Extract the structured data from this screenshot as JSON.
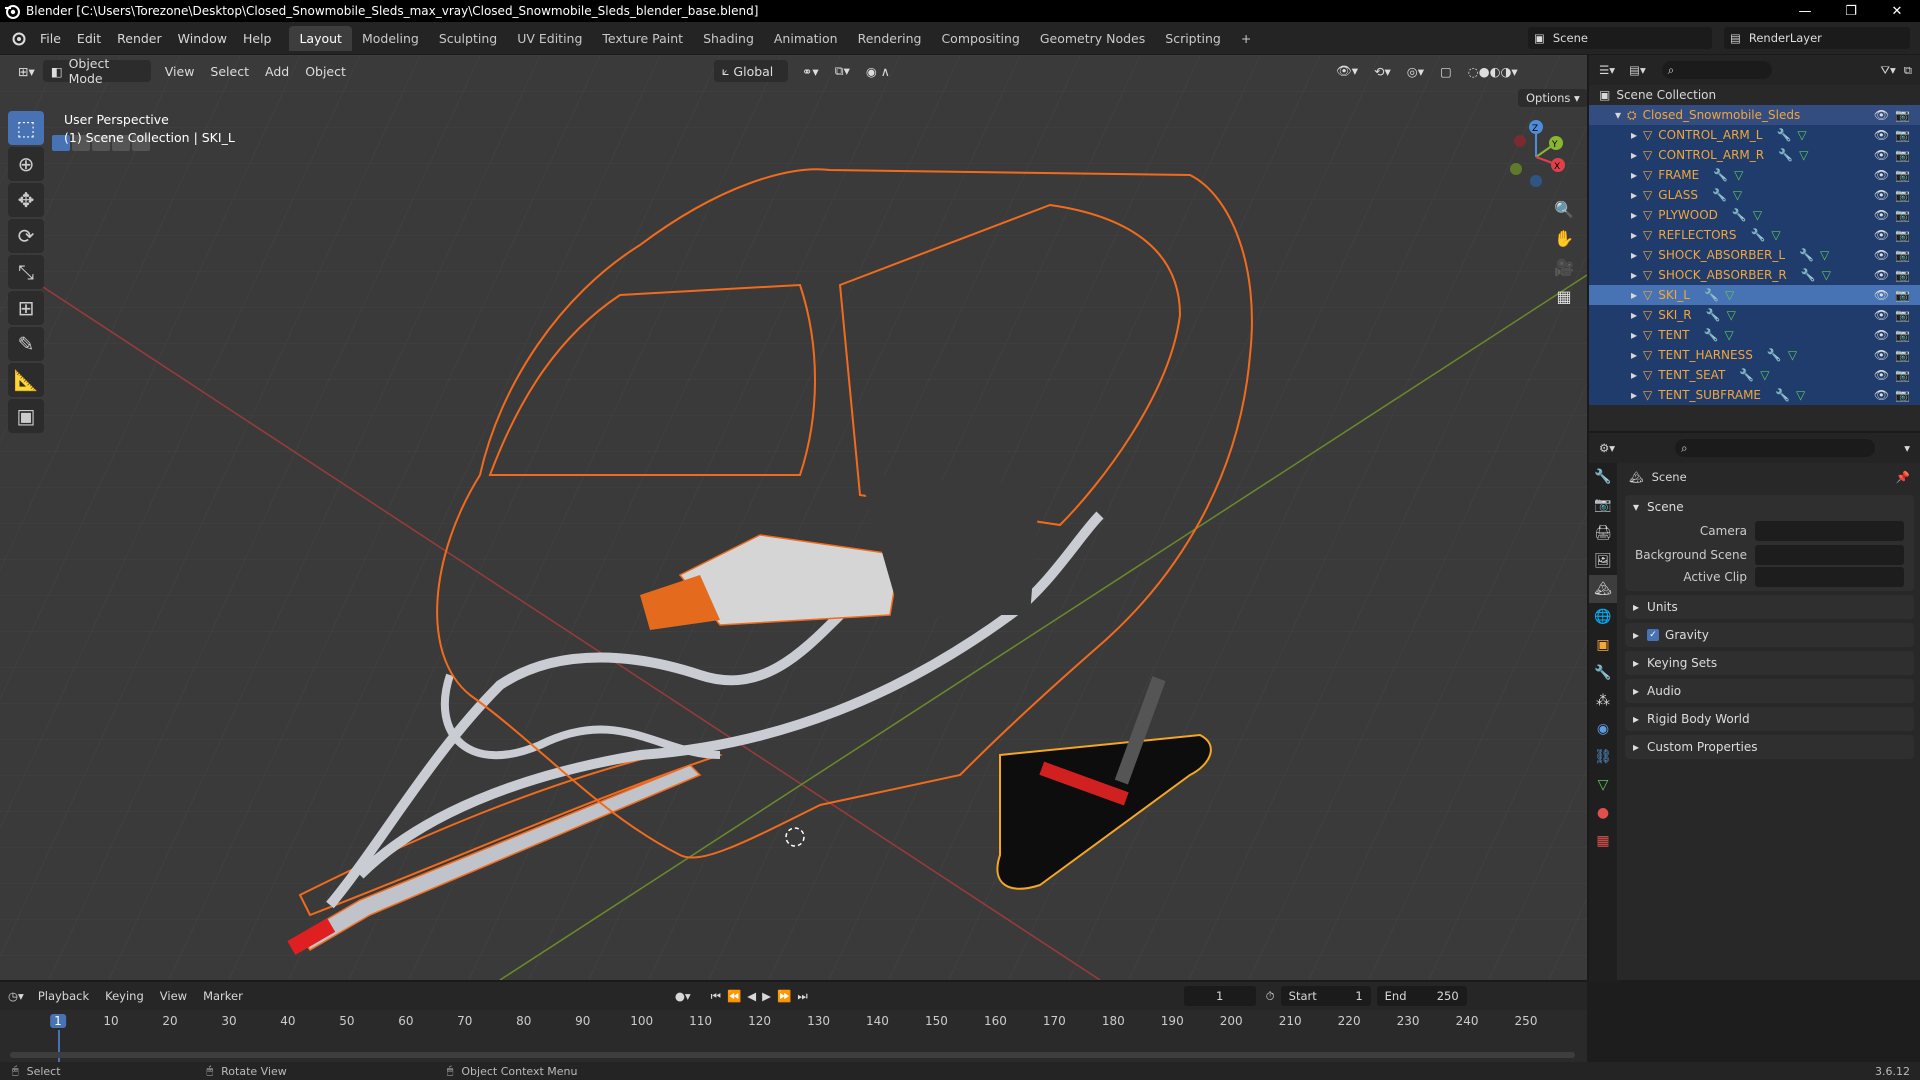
{
  "window": {
    "title": "Blender [C:\\Users\\Torezone\\Desktop\\Closed_Snowmobile_Sleds_max_vray\\Closed_Snowmobile_Sleds_blender_base.blend]"
  },
  "menu": [
    "File",
    "Edit",
    "Render",
    "Window",
    "Help"
  ],
  "workspaces": [
    "Layout",
    "Modeling",
    "Sculpting",
    "UV Editing",
    "Texture Paint",
    "Shading",
    "Animation",
    "Rendering",
    "Compositing",
    "Geometry Nodes",
    "Scripting"
  ],
  "active_workspace": "Layout",
  "scene_name": "Scene",
  "view_layer": "RenderLayer",
  "viewport": {
    "mode": "Object Mode",
    "menus": [
      "View",
      "Select",
      "Add",
      "Object"
    ],
    "transform_orientation": "Global",
    "options_label": "Options",
    "perspective": "User Perspective",
    "collection_info": "(1) Scene Collection | SKI_L"
  },
  "outliner": {
    "root": "Scene Collection",
    "collection": "Closed_Snowmobile_Sleds",
    "objects": [
      "CONTROL_ARM_L",
      "CONTROL_ARM_R",
      "FRAME",
      "GLASS",
      "PLYWOOD",
      "REFLECTORS",
      "SHOCK_ABSORBER_L",
      "SHOCK_ABSORBER_R",
      "SKI_L",
      "SKI_R",
      "TENT",
      "TENT_HARNESS",
      "TENT_SEAT",
      "TENT_SUBFRAME"
    ],
    "active_object": "SKI_L"
  },
  "properties": {
    "header": "Scene",
    "panel": "Scene",
    "fields": {
      "camera": "Camera",
      "background_scene": "Background Scene",
      "active_clip": "Active Clip"
    },
    "subpanels": [
      "Units",
      "Gravity",
      "Keying Sets",
      "Audio",
      "Rigid Body World",
      "Custom Properties"
    ],
    "gravity_checked": true
  },
  "timeline": {
    "menus": [
      "Playback",
      "Keying",
      "View",
      "Marker"
    ],
    "current_frame": "1",
    "start_label": "Start",
    "start": "1",
    "end_label": "End",
    "end": "250",
    "ticks": [
      "1",
      "10",
      "20",
      "30",
      "40",
      "50",
      "60",
      "70",
      "80",
      "90",
      "100",
      "110",
      "120",
      "130",
      "140",
      "150",
      "160",
      "170",
      "180",
      "190",
      "200",
      "210",
      "220",
      "230",
      "240",
      "250"
    ]
  },
  "status": {
    "select": "Select",
    "rotate": "Rotate View",
    "context": "Object Context Menu",
    "version": "3.6.12"
  },
  "colors": {
    "accent": "#4772b3",
    "selection": "#f26b1d",
    "object_name": "#f3a63a"
  }
}
